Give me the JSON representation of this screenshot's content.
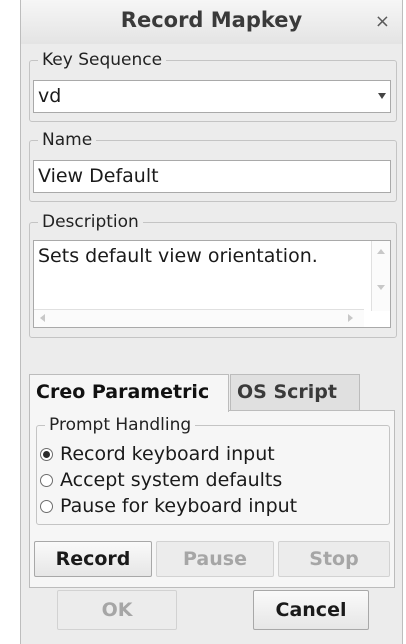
{
  "dialog": {
    "title": "Record Mapkey",
    "close_glyph": "×"
  },
  "key_sequence": {
    "legend": "Key Sequence",
    "value": "vd"
  },
  "name": {
    "legend": "Name",
    "value": "View Default"
  },
  "description": {
    "legend": "Description",
    "value": "Sets default view orientation."
  },
  "tabs": [
    {
      "label": "Creo Parametric",
      "active": true
    },
    {
      "label": "OS Script",
      "active": false
    }
  ],
  "prompt_handling": {
    "legend": "Prompt Handling",
    "options": [
      {
        "label": "Record keyboard input",
        "selected": true
      },
      {
        "label": "Accept system defaults",
        "selected": false
      },
      {
        "label": "Pause for keyboard input",
        "selected": false
      }
    ]
  },
  "record_controls": {
    "record": "Record",
    "pause": "Pause",
    "stop": "Stop"
  },
  "footer": {
    "ok": "OK",
    "cancel": "Cancel"
  }
}
